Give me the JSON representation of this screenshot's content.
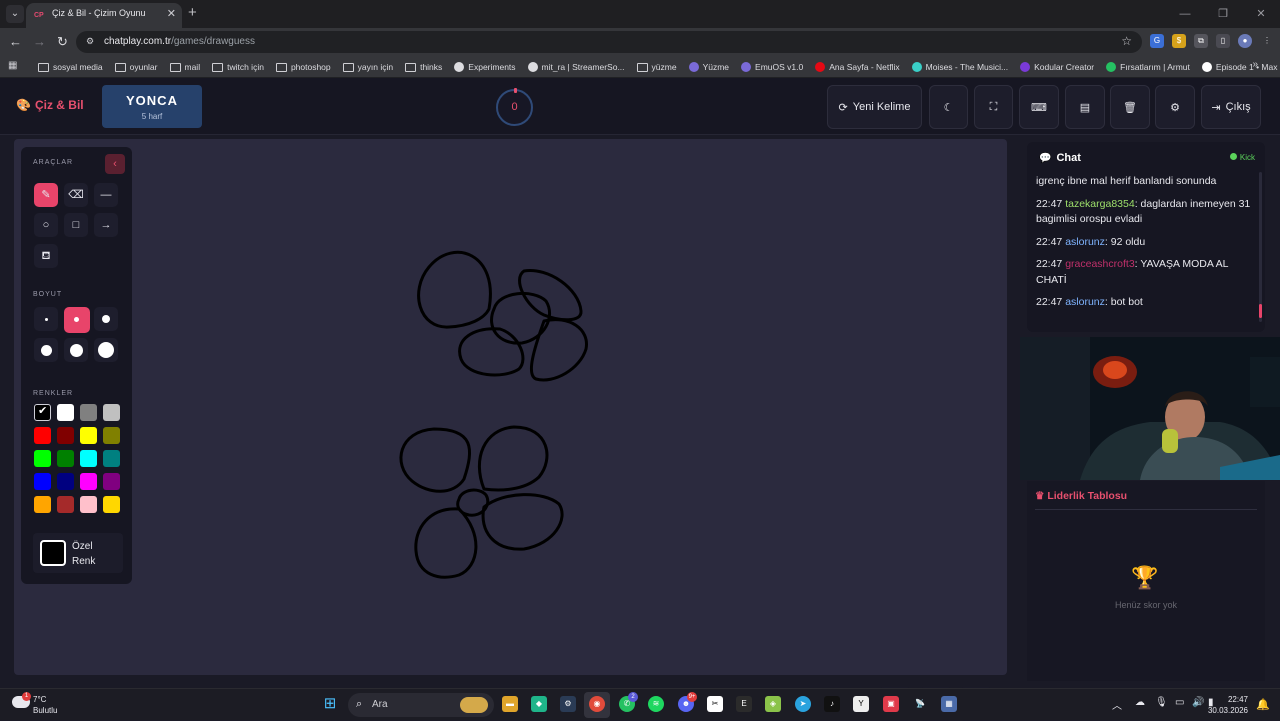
{
  "browser": {
    "tab_title": "Çiz & Bil - Çizim Oyunu",
    "tab_favicon": "CP",
    "url_host": "chatplay.com.tr",
    "url_path": "/games/drawguess",
    "bookmarks": [
      {
        "label": "sosyal media",
        "icon": "folder-icon"
      },
      {
        "label": "oyunlar",
        "icon": "folder-icon"
      },
      {
        "label": "mail",
        "icon": "folder-icon"
      },
      {
        "label": "twitch için",
        "icon": "folder-icon"
      },
      {
        "label": "photoshop",
        "icon": "folder-icon"
      },
      {
        "label": "yayın için",
        "icon": "folder-icon"
      },
      {
        "label": "thinks",
        "icon": "folder-icon"
      },
      {
        "label": "Experiments",
        "icon": "flask-icon"
      },
      {
        "label": "mit_ra | StreamerSo...",
        "icon": "music-icon"
      },
      {
        "label": "yüzme",
        "icon": "folder-icon"
      },
      {
        "label": "Yüzme",
        "icon": "site-icon"
      },
      {
        "label": "EmuOS v1.0",
        "icon": "site-icon"
      },
      {
        "label": "Ana Sayfa - Netflix",
        "icon": "netflix-icon"
      },
      {
        "label": "Moises - The Musici...",
        "icon": "moises-icon"
      },
      {
        "label": "Kodular Creator",
        "icon": "kodular-icon"
      },
      {
        "label": "Fırsatlarım | Armut",
        "icon": "armut-icon"
      },
      {
        "label": "Episode 1 • Max",
        "icon": "max-icon"
      }
    ]
  },
  "app": {
    "logo": "Çiz & Bil",
    "word": "YONCA",
    "word_length": "5 harf",
    "timer": "0",
    "buttons": {
      "new_word": "Yeni Kelime",
      "exit": "Çıkış"
    }
  },
  "tools": {
    "section_tools": "ARAÇLAR",
    "section_size": "BOYUT",
    "section_colors": "RENKLER",
    "custom_color": "Özel Renk",
    "active_tool": "brush",
    "active_size_index": 1,
    "palette": [
      "#000000",
      "#ffffff",
      "#808080",
      "#c0c0c0",
      "#ff0000",
      "#800000",
      "#ffff00",
      "#808000",
      "#00ff00",
      "#008000",
      "#00ffff",
      "#008080",
      "#0000ff",
      "#000080",
      "#ff00ff",
      "#800080",
      "#ffa500",
      "#a52a2a",
      "#ffc0cb",
      "#ffd700"
    ],
    "selected_color": "#000000"
  },
  "chat": {
    "title": "Chat",
    "source": "Kick",
    "messages": [
      {
        "time": "",
        "user": "",
        "color": "#e8e8ee",
        "text": "igrenç ibne mal herif banlandi sonunda"
      },
      {
        "time": "22:47",
        "user": "tazekarga8354",
        "color": "#9ee06b",
        "text": ": daglardan inemeyen 31 bagimlisi orospu evladi"
      },
      {
        "time": "22:47",
        "user": "aslorunz",
        "color": "#7fb4ff",
        "text": ": 92 oldu"
      },
      {
        "time": "22:47",
        "user": "graceashcroft3",
        "color": "#c0306a",
        "text": ": YAVAŞA MODA AL CHATİ"
      },
      {
        "time": "22:47",
        "user": "aslorunz",
        "color": "#7fb4ff",
        "text": ": bot bot"
      }
    ]
  },
  "leaderboard": {
    "title": "Liderlik Tablosu",
    "empty": "Henüz skor yok"
  },
  "taskbar": {
    "temperature": "7°C",
    "weather": "Bulutlu",
    "weather_badge": "1",
    "search": "Ara",
    "time": "22:47",
    "date": "30.03.2026",
    "badges": {
      "whatsapp": "2",
      "discord": "9+"
    }
  }
}
